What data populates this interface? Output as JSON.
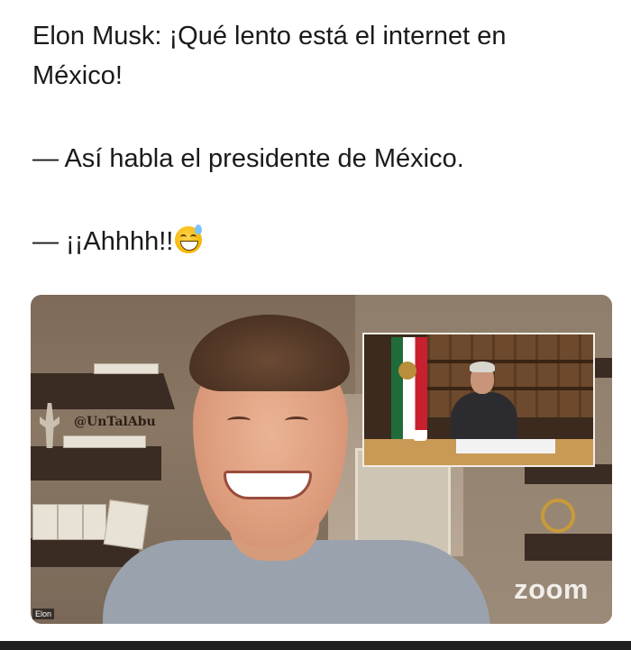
{
  "caption": {
    "line1": "Elon Musk: ¡Qué lento está el internet en",
    "line2": "México!",
    "line3": "— Así habla el presidente de México.",
    "line4": "— ¡¡Ahhhh!!",
    "emoji": "grinning-face-with-sweat"
  },
  "video": {
    "watermark": "@UnTalAbu",
    "app_logo": "zoom",
    "participant_name": "Elon"
  },
  "colors": {
    "text": "#1a1a1a",
    "background": "#ffffff",
    "zoom_logo": "#ffffff"
  }
}
